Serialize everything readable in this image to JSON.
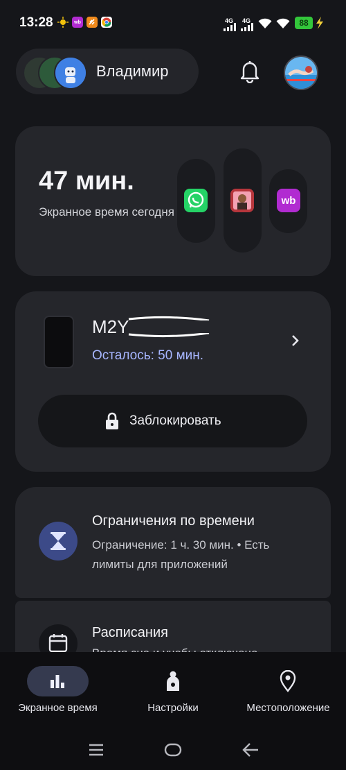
{
  "status_bar": {
    "time": "13:28",
    "notifications": [
      {
        "name": "weather-icon",
        "text": "",
        "color": "#f2c20c"
      },
      {
        "name": "wb-notif-icon",
        "text": "wb",
        "color": "#b12bd1"
      },
      {
        "name": "orange-app-icon",
        "text": "",
        "color": "#f08a1c"
      },
      {
        "name": "chrome-icon",
        "text": "",
        "color": "#4a8ae8"
      }
    ],
    "signal_1": "4G",
    "signal_2": "4G",
    "battery": "88"
  },
  "header": {
    "user_name": "Владимир",
    "icons": {
      "bell": "bell-icon",
      "profile": "user-avatar"
    }
  },
  "screen_time_card": {
    "minutes": "47 мин.",
    "label": "Экранное время сегодня",
    "apps": [
      {
        "name": "whatsapp-icon",
        "color": "#25d366",
        "bar_level": 0.55
      },
      {
        "name": "game-app-icon",
        "color": "#c5474c",
        "bar_level": 0.9
      },
      {
        "name": "wildberries-icon",
        "color": "#b12bd1",
        "text": "wb",
        "bar_level": 0.35
      }
    ]
  },
  "device_card": {
    "device_name": "M2Y",
    "remaining": "Осталось: 50 мин.",
    "lock_label": "Заблокировать"
  },
  "limits_card": {
    "title": "Ограничения по времени",
    "subtitle": "Ограничение: 1 ч. 30 мин. • Есть лимиты для приложений"
  },
  "schedule_card": {
    "title": "Расписания",
    "subtitle": "Время сна и учебы отключено"
  },
  "bottom_nav": {
    "items": [
      {
        "label": "Экранное время",
        "icon": "bar-chart-icon",
        "active": true
      },
      {
        "label": "Настройки",
        "icon": "family-settings-icon",
        "active": false
      },
      {
        "label": "Местоположение",
        "icon": "location-pin-icon",
        "active": false
      }
    ]
  },
  "colors": {
    "background": "#15161a",
    "card": "#25262b",
    "accent_text": "#a7b6ff",
    "active_nav": "#353a4f"
  }
}
